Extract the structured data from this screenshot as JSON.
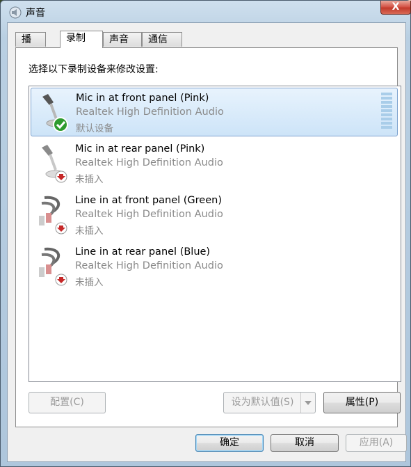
{
  "window": {
    "title": "声音",
    "close_label": "X"
  },
  "tabs": [
    {
      "label": "播放"
    },
    {
      "label": "录制"
    },
    {
      "label": "声音"
    },
    {
      "label": "通信"
    }
  ],
  "instruction": "选择以下录制设备来修改设置:",
  "devices": [
    {
      "name": "Mic in at front panel (Pink)",
      "driver": "Realtek High Definition Audio",
      "status": "默认设备"
    },
    {
      "name": "Mic in at rear panel (Pink)",
      "driver": "Realtek High Definition Audio",
      "status": "未插入"
    },
    {
      "name": "Line in at front panel (Green)",
      "driver": "Realtek High Definition Audio",
      "status": "未插入"
    },
    {
      "name": "Line in at rear panel (Blue)",
      "driver": "Realtek High Definition Audio",
      "status": "未插入"
    }
  ],
  "buttons": {
    "configure": "配置(C)",
    "set_default": "设为默认值(S)",
    "properties": "属性(P)",
    "ok": "确定",
    "cancel": "取消",
    "apply": "应用(A)"
  },
  "icons": {
    "title": "speaker-icon",
    "mic": "microphone-icon",
    "line": "audio-cable-icon",
    "default": "green-check-badge-icon",
    "unplugged": "red-down-arrow-badge-icon"
  }
}
